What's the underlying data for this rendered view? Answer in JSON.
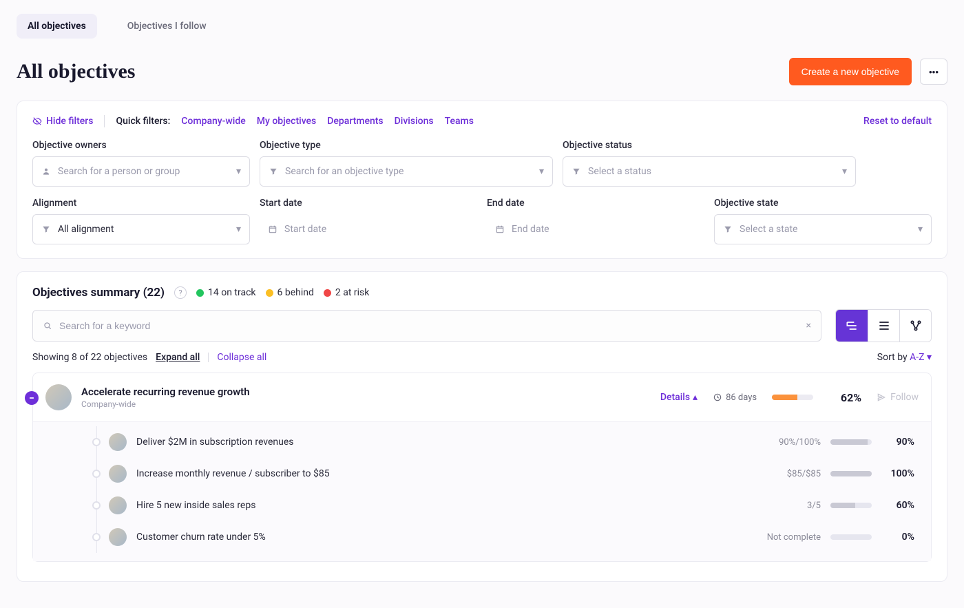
{
  "tabs": {
    "all": "All objectives",
    "follow": "Objectives I follow"
  },
  "page_title": "All objectives",
  "header": {
    "create_label": "Create a new objective"
  },
  "filters": {
    "hide": "Hide filters",
    "quick_label": "Quick filters:",
    "quick": [
      "Company-wide",
      "My objectives",
      "Departments",
      "Divisions",
      "Teams"
    ],
    "reset": "Reset to default",
    "owners_label": "Objective owners",
    "owners_placeholder": "Search for a person or group",
    "type_label": "Objective type",
    "type_placeholder": "Search for an objective type",
    "status_label": "Objective status",
    "status_placeholder": "Select a status",
    "alignment_label": "Alignment",
    "alignment_value": "All alignment",
    "start_label": "Start date",
    "start_placeholder": "Start date",
    "end_label": "End date",
    "end_placeholder": "End date",
    "state_label": "Objective state",
    "state_placeholder": "Select a state"
  },
  "summary": {
    "title": "Objectives summary (22)",
    "on_track": "14 on track",
    "behind": "6 behind",
    "at_risk": "2 at risk",
    "search_placeholder": "Search for a keyword",
    "showing": "Showing 8 of 22 objectives",
    "expand": "Expand all",
    "collapse": "Collapse all",
    "sort_label": "Sort by ",
    "sort_value": "A-Z"
  },
  "objective": {
    "title": "Accelerate recurring revenue growth",
    "scope": "Company-wide",
    "details": "Details",
    "days": "86 days",
    "pct": "62%",
    "progress_width": "62%",
    "follow": "Follow",
    "krs": [
      {
        "title": "Deliver $2M in subscription revenues",
        "metric": "90%/100%",
        "pct": "90%",
        "w": "90%"
      },
      {
        "title": "Increase monthly revenue / subscriber to $85",
        "metric": "$85/$85",
        "pct": "100%",
        "w": "100%"
      },
      {
        "title": "Hire 5 new inside sales reps",
        "metric": "3/5",
        "pct": "60%",
        "w": "60%"
      },
      {
        "title": "Customer churn rate under 5%",
        "metric": "Not complete",
        "pct": "0%",
        "w": "0%"
      }
    ]
  }
}
